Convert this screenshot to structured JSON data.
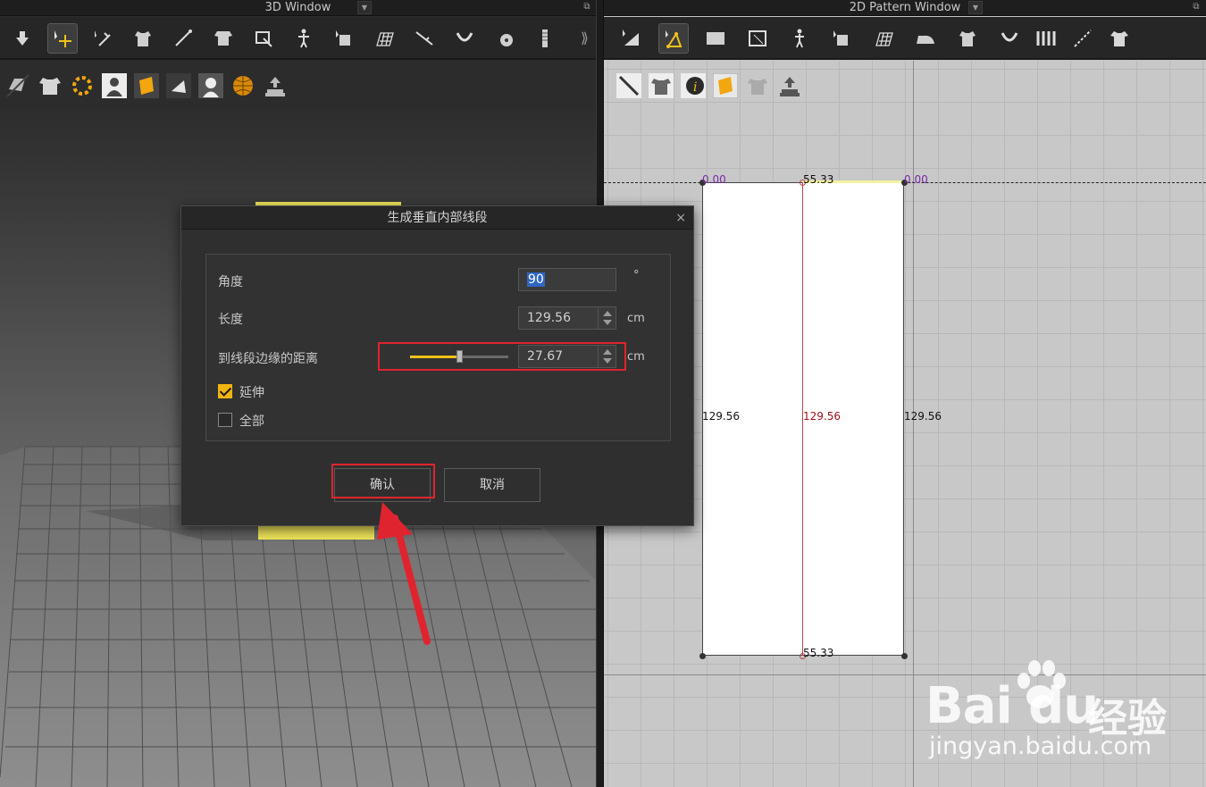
{
  "window3d": {
    "title": "3D Window",
    "more": "⟫"
  },
  "window2d": {
    "title": "2D Pattern Window"
  },
  "toolbar3d": [
    {
      "icon": "select-move-icon"
    },
    {
      "icon": "transform-gizmo-icon"
    },
    {
      "icon": "pin-icon"
    },
    {
      "icon": "tack-icon"
    },
    {
      "icon": "sewing-icon"
    },
    {
      "icon": "fold-arrangement-icon"
    },
    {
      "icon": "avatar-pose-icon"
    },
    {
      "icon": "arrangement-icon"
    },
    {
      "icon": "fabric-grid-icon"
    },
    {
      "icon": "measure-icon"
    },
    {
      "icon": "strap-icon"
    },
    {
      "icon": "button-icon"
    },
    {
      "icon": "zipper-icon"
    }
  ],
  "toolbar2d": [
    {
      "icon": "edit-pattern-icon"
    },
    {
      "icon": "edit-point-line-icon",
      "active": true
    },
    {
      "icon": "rectangle-icon"
    },
    {
      "icon": "polygon-icon"
    },
    {
      "icon": "avatar-icon"
    },
    {
      "icon": "arrangement-icon"
    },
    {
      "icon": "grid-icon"
    },
    {
      "icon": "iron-icon"
    },
    {
      "icon": "garment-icon"
    },
    {
      "icon": "seam-icon"
    },
    {
      "icon": "pleats-icon"
    },
    {
      "icon": "internal-line-icon"
    },
    {
      "icon": "shirt-icon"
    }
  ],
  "dialog": {
    "title": "生成垂直内部线段",
    "close": "×",
    "angle_label": "角度",
    "angle_value": "90",
    "angle_unit": "°",
    "length_label": "长度",
    "length_value": "129.56",
    "length_unit": "cm",
    "distance_label": "到线段边缘的距离",
    "distance_value": "27.67",
    "distance_unit": "cm",
    "distance_slider_fraction": 0.5,
    "extend_label": "延伸",
    "extend_checked": true,
    "all_label": "全部",
    "all_checked": false,
    "confirm_label": "确认",
    "cancel_label": "取消"
  },
  "pattern": {
    "top_left": "0.00",
    "top_mid": "55.33",
    "top_right": "0.00",
    "left_len": "129.56",
    "mid_len": "129.56",
    "right_len": "129.56",
    "bottom_mid": "55.33"
  },
  "watermark": {
    "brand": "Bai du",
    "cn": "经验",
    "url": "jingyan.baidu.com"
  },
  "colors": {
    "accent": "#f2c21a",
    "highlight_box": "#e0242f",
    "inner_line": "#b5484e"
  }
}
